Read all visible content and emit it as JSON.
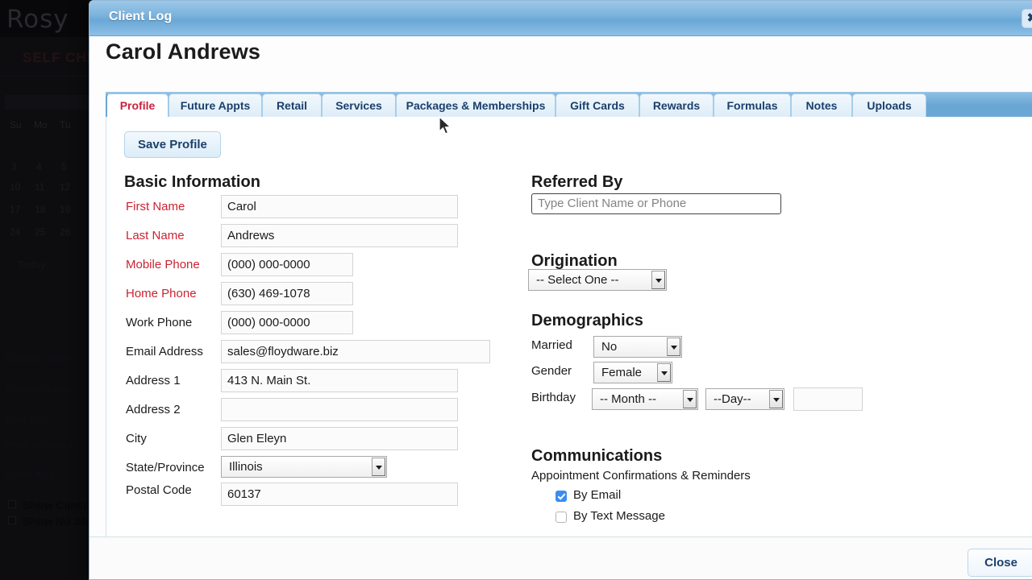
{
  "background_app": {
    "logo": "Rosy",
    "self_check_label": "SELF CHECK",
    "calendar": {
      "day_headers": [
        "Su",
        "Mo",
        "Tu"
      ],
      "weeks": [
        [
          "3",
          "4",
          "5"
        ],
        [
          "10",
          "11",
          "12"
        ],
        [
          "17",
          "18",
          "19"
        ],
        [
          "24",
          "25",
          "26"
        ]
      ],
      "today_label": "Today"
    },
    "nav_items": [
      "Custom View",
      "Appointments",
      "Wait List",
      "Print Schedule",
      "Color Key"
    ],
    "toggles": [
      {
        "label": "Show Cancelled",
        "checked": false
      },
      {
        "label": "Show No Shows",
        "checked": false
      }
    ]
  },
  "modal": {
    "title": "Client Log",
    "close_icon": "close-icon",
    "close_glyph": "✖",
    "client_name": "Carol Andrews",
    "tabs": [
      {
        "label": "Profile",
        "active": true
      },
      {
        "label": "Future Appts",
        "active": false
      },
      {
        "label": "Retail",
        "active": false
      },
      {
        "label": "Services",
        "active": false
      },
      {
        "label": "Packages & Memberships",
        "active": false
      },
      {
        "label": "Gift Cards",
        "active": false
      },
      {
        "label": "Rewards",
        "active": false
      },
      {
        "label": "Formulas",
        "active": false
      },
      {
        "label": "Notes",
        "active": false
      },
      {
        "label": "Uploads",
        "active": false
      }
    ],
    "save_profile_label": "Save Profile",
    "basic_information": {
      "heading": "Basic Information",
      "fields": [
        {
          "label": "First Name",
          "value": "Carol",
          "required": true
        },
        {
          "label": "Last Name",
          "value": "Andrews",
          "required": true
        },
        {
          "label": "Mobile Phone",
          "value": "(000) 000-0000",
          "required": true
        },
        {
          "label": "Home Phone",
          "value": "(630) 469-1078",
          "required": true
        },
        {
          "label": "Work Phone",
          "value": "(000) 000-0000",
          "required": false
        },
        {
          "label": "Email Address",
          "value": "sales@floydware.biz",
          "required": false
        },
        {
          "label": "Address 1",
          "value": "413 N. Main St.",
          "required": false
        },
        {
          "label": "Address 2",
          "value": "",
          "required": false
        },
        {
          "label": "City",
          "value": "Glen Eleyn",
          "required": false
        },
        {
          "label": "State/Province",
          "value": "Illinois",
          "required": false
        },
        {
          "label": "Postal Code",
          "value": "60137",
          "required": false
        }
      ]
    },
    "referred_by": {
      "heading": "Referred By",
      "placeholder": "Type Client Name or Phone",
      "value": ""
    },
    "origination": {
      "heading": "Origination",
      "selected": "-- Select One --"
    },
    "demographics": {
      "heading": "Demographics",
      "married_label": "Married",
      "married_value": "No",
      "gender_label": "Gender",
      "gender_value": "Female",
      "birthday_label": "Birthday",
      "birthday_month": "-- Month --",
      "birthday_day": "--Day--",
      "birthday_year": ""
    },
    "communications": {
      "heading": "Communications",
      "subheading": "Appointment Confirmations & Reminders",
      "options": [
        {
          "label": "By Email",
          "checked": true
        },
        {
          "label": "By Text Message",
          "checked": false
        }
      ]
    },
    "footer": {
      "close_label": "Close"
    }
  },
  "colors": {
    "titlebar_blue": "#7ab3dd",
    "tab_active_text": "#c9213e",
    "tab_text": "#1b3f6b",
    "required_label": "#cc2233",
    "checkbox_checked": "#3b8ef0"
  }
}
